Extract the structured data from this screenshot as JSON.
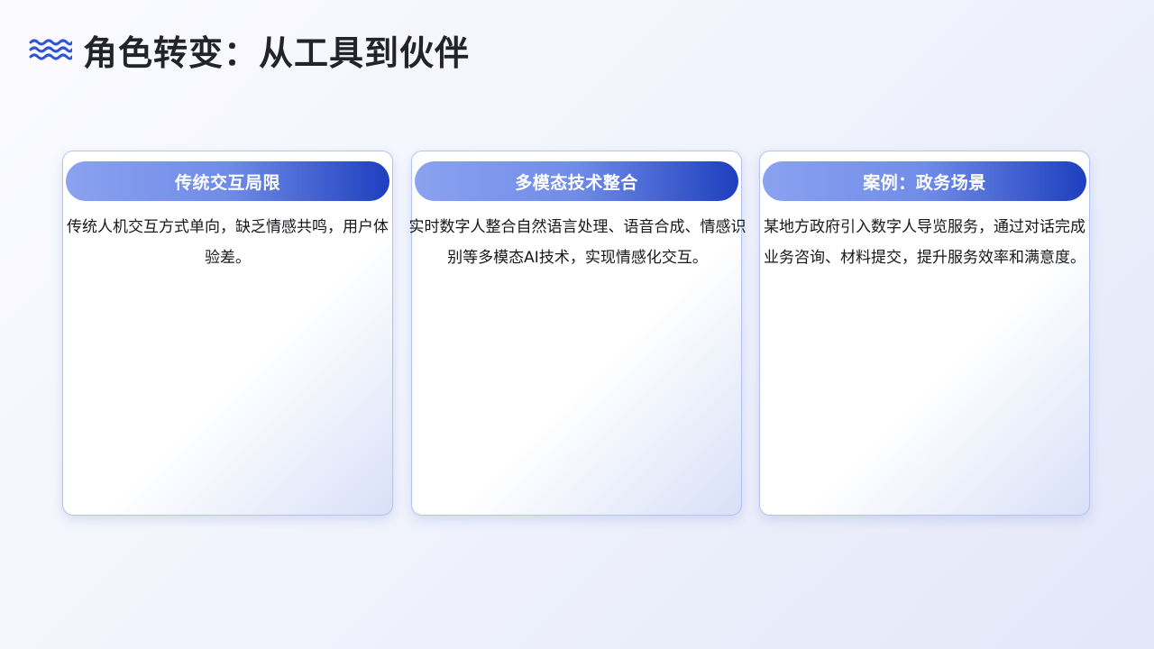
{
  "header": {
    "icon": "wave-icon",
    "title": "角色转变：从工具到伙伴"
  },
  "colors": {
    "accent": "#2f54d9",
    "header_gradient_start": "#8aa2ef",
    "header_gradient_end": "#1e3fbf",
    "card_border": "#b6c2ef"
  },
  "cards": [
    {
      "title": "传统交互局限",
      "body": "传统人机交互方式单向，缺乏情感共鸣，用户体验差。"
    },
    {
      "title": "多模态技术整合",
      "body": "实时数字人整合自然语言处理、语音合成、情感识别等多模态AI技术，实现情感化交互。"
    },
    {
      "title": "案例：政务场景",
      "body": "某地方政府引入数字人导览服务，通过对话完成业务咨询、材料提交，提升服务效率和满意度。"
    }
  ]
}
